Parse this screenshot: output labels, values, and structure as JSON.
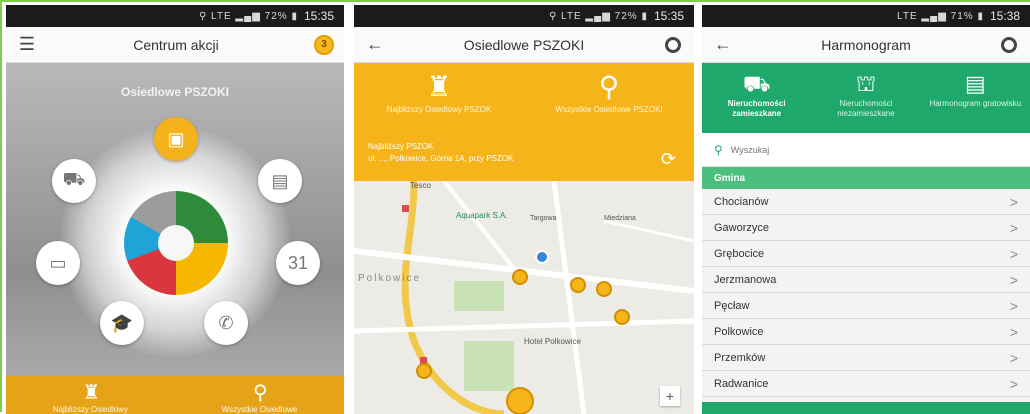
{
  "status_bars": [
    {
      "icons": "⚲ LTE ▂▄▆ 72% ▮",
      "time": "15:35"
    },
    {
      "icons": "⚲ LTE ▂▄▆ 72% ▮",
      "time": "15:35"
    },
    {
      "icons": "LTE ▂▄▆ 71% ▮",
      "time": "15:38"
    }
  ],
  "screen1": {
    "title": "Centrum akcji",
    "badge": "3",
    "section_title": "Osiedlowe PSZOKI",
    "bottom_labels": [
      "Najbliższy Osiedlowy",
      "Wszystkie Osiedlowe"
    ]
  },
  "screen2": {
    "title": "Osiedlowe PSZOKI",
    "tabs": [
      "Najbliższy Osiedlowy PSZOK",
      "Wszystkie Osiedlowe PSZOKI"
    ],
    "nearest_label": "Najbliższy PSZOK",
    "nearest_address": "ul. ..., Polkowice, Górna 1A, przy PSZOK",
    "map_labels": {
      "tesco": "Tesco",
      "aquapark": "Aquapark S.A.",
      "city": "Polkowice",
      "hotel": "Hotel Polkowice",
      "targowa": "Targowa",
      "miedziana": "Miedziana"
    },
    "zoom_in": "+"
  },
  "screen3": {
    "title": "Harmonogram",
    "tabs": [
      "Nieruchomości zamieszkane",
      "Nieruchomości niezamieszkane",
      "Harmonogram gratowisku"
    ],
    "search_placeholder": "Wyszukaj",
    "list_header": "Gmina",
    "gminy": [
      "Chocianów",
      "Gaworzyce",
      "Grębocice",
      "Jerzmanowa",
      "Pęcław",
      "Polkowice",
      "Przemków",
      "Radwanice"
    ]
  },
  "colors": {
    "orange": "#f5b41a",
    "green": "#1fa86b",
    "list_header": "#4cbf7e"
  }
}
